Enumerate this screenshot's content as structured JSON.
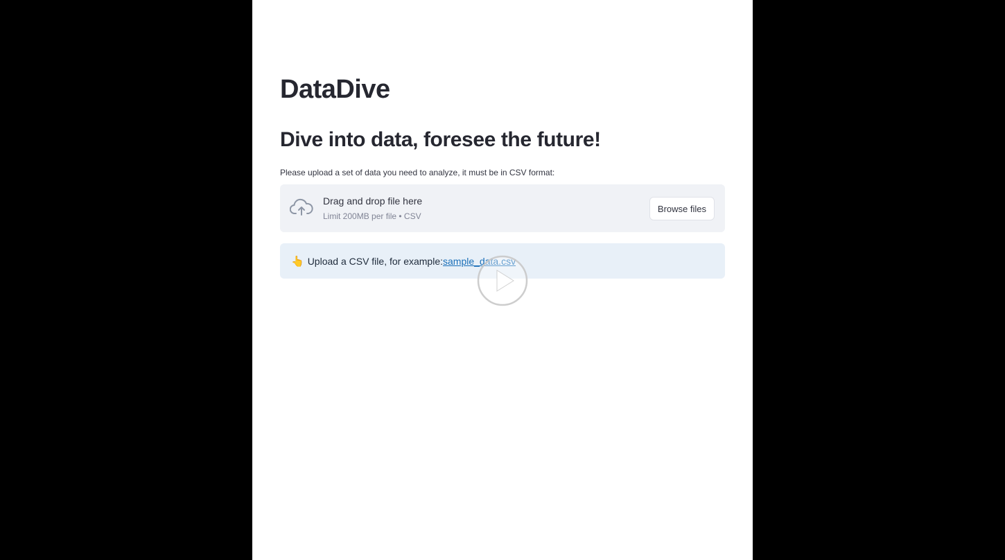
{
  "app": {
    "title": "DataDive",
    "subtitle": "Dive into data, foresee the future!"
  },
  "uploader": {
    "instructions": "Please upload a set of data you need to analyze, it must be in CSV format:",
    "drop_label": "Drag and drop file here",
    "limit_label": "Limit 200MB per file • CSV",
    "browse_label": "Browse files",
    "icon": "cloud-upload-icon"
  },
  "info": {
    "icon": "👆",
    "text": "Upload a CSV file, for example:",
    "link_text": "sample_data.csv"
  },
  "colors": {
    "background": "#ffffff",
    "letterbox": "#000000",
    "dropzone": "#f0f2f6",
    "info_bg": "#e8f0f8",
    "link": "#1a6fb8",
    "text": "#262730"
  },
  "overlay": {
    "icon": "play-icon"
  }
}
